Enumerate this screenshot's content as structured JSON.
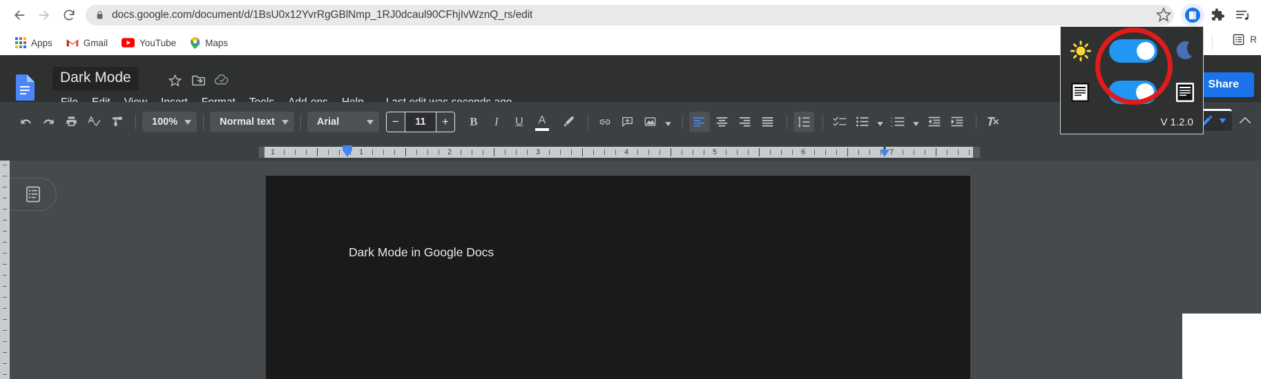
{
  "browser": {
    "back_icon": "arrow-left-icon",
    "forward_icon": "arrow-right-icon",
    "reload_icon": "reload-icon",
    "lock_icon": "lock-icon",
    "url_full": "docs.google.com/document/d/1BsU0x12YvrRgGBlNmp_1RJ0dcaul90CFhjIvWznQ_rs/edit",
    "url_domain": "docs.google.com",
    "url_path": "/document/d/1BsU0x12YvrRgGBlNmp_1RJ0dcaul90CFhjIvWznQ_rs/edit",
    "star_icon": "bookmark-star-icon",
    "extension_icon": "dark-mode-extension-icon",
    "puzzle_icon": "extensions-puzzle-icon",
    "playlist_icon": "media-playlist-icon",
    "bookmarks": [
      {
        "label": "Apps",
        "icon": "apps-grid-icon"
      },
      {
        "label": "Gmail",
        "icon": "gmail-icon"
      },
      {
        "label": "YouTube",
        "icon": "youtube-icon"
      },
      {
        "label": "Maps",
        "icon": "maps-pin-icon"
      }
    ],
    "bookmark_right": {
      "label": "R",
      "icon": "reading-list-icon"
    }
  },
  "extension_popup": {
    "sun_icon": "sun-icon",
    "moon_icon": "moon-icon",
    "doc_light_icon": "document-light-icon",
    "doc_dark_icon": "document-dark-icon",
    "toggle_theme_state": "on",
    "toggle_doc_state": "on",
    "version": "V 1.2.0",
    "accent_color": "#2196f3",
    "annotation_color": "#e01b1b",
    "background_color": "#2f3030"
  },
  "docs": {
    "logo_icon": "google-docs-logo",
    "title": "Dark Mode",
    "title_icons": [
      {
        "name": "star-icon",
        "label": "star"
      },
      {
        "name": "move-to-folder-icon",
        "label": "move"
      },
      {
        "name": "cloud-saved-icon",
        "label": "saved-to-drive"
      }
    ],
    "menus": [
      "File",
      "Edit",
      "View",
      "Insert",
      "Format",
      "Tools",
      "Add-ons",
      "Help"
    ],
    "last_edit": "Last edit was seconds ago",
    "share_label": "Share",
    "history_icon": "activity-history-icon",
    "comment_icon": "comment-history-icon",
    "accent_color": "#1a73e8",
    "header_bg": "#2f3030",
    "toolbar_bg": "#3c4043"
  },
  "toolbar": {
    "undo_icon": "undo-icon",
    "redo_icon": "redo-icon",
    "print_icon": "print-icon",
    "spellcheck_icon": "spellcheck-icon",
    "paint_format_icon": "paint-format-icon",
    "zoom_value": "100%",
    "paragraph_style": "Normal text",
    "font_family": "Arial",
    "font_size": "11",
    "font_size_minus": "−",
    "font_size_plus": "+",
    "bold_label": "B",
    "italic_label": "I",
    "underline_label": "U",
    "text_color_label": "A",
    "highlight_icon": "highlight-pen-icon",
    "link_icon": "insert-link-icon",
    "comment_icon": "add-comment-icon",
    "image_icon": "insert-image-icon",
    "align_left_icon": "align-left-icon",
    "align_center_icon": "align-center-icon",
    "align_right_icon": "align-right-icon",
    "align_justify_icon": "align-justify-icon",
    "line_spacing_icon": "line-spacing-icon",
    "checklist_icon": "checklist-icon",
    "bulleted_list_icon": "bulleted-list-icon",
    "numbered_list_icon": "numbered-list-icon",
    "decrease_indent_icon": "decrease-indent-icon",
    "increase_indent_icon": "increase-indent-icon",
    "clear_formatting_icon": "clear-formatting-icon",
    "edit_mode_icon": "edit-pencil-icon",
    "collapse_icon": "collapse-toolbar-icon",
    "active_align": "align-left"
  },
  "ruler": {
    "numbers": [
      "1",
      "1",
      "2",
      "3",
      "4",
      "5",
      "6",
      "7"
    ],
    "left_indent_marker": "left-indent-marker",
    "right_indent_marker": "right-indent-marker",
    "unit": "inches"
  },
  "document": {
    "outline_icon": "document-outline-icon",
    "body_text": "Dark Mode in Google Docs",
    "page_bg": "#1a1a1a",
    "text_color": "#e8eaed"
  }
}
